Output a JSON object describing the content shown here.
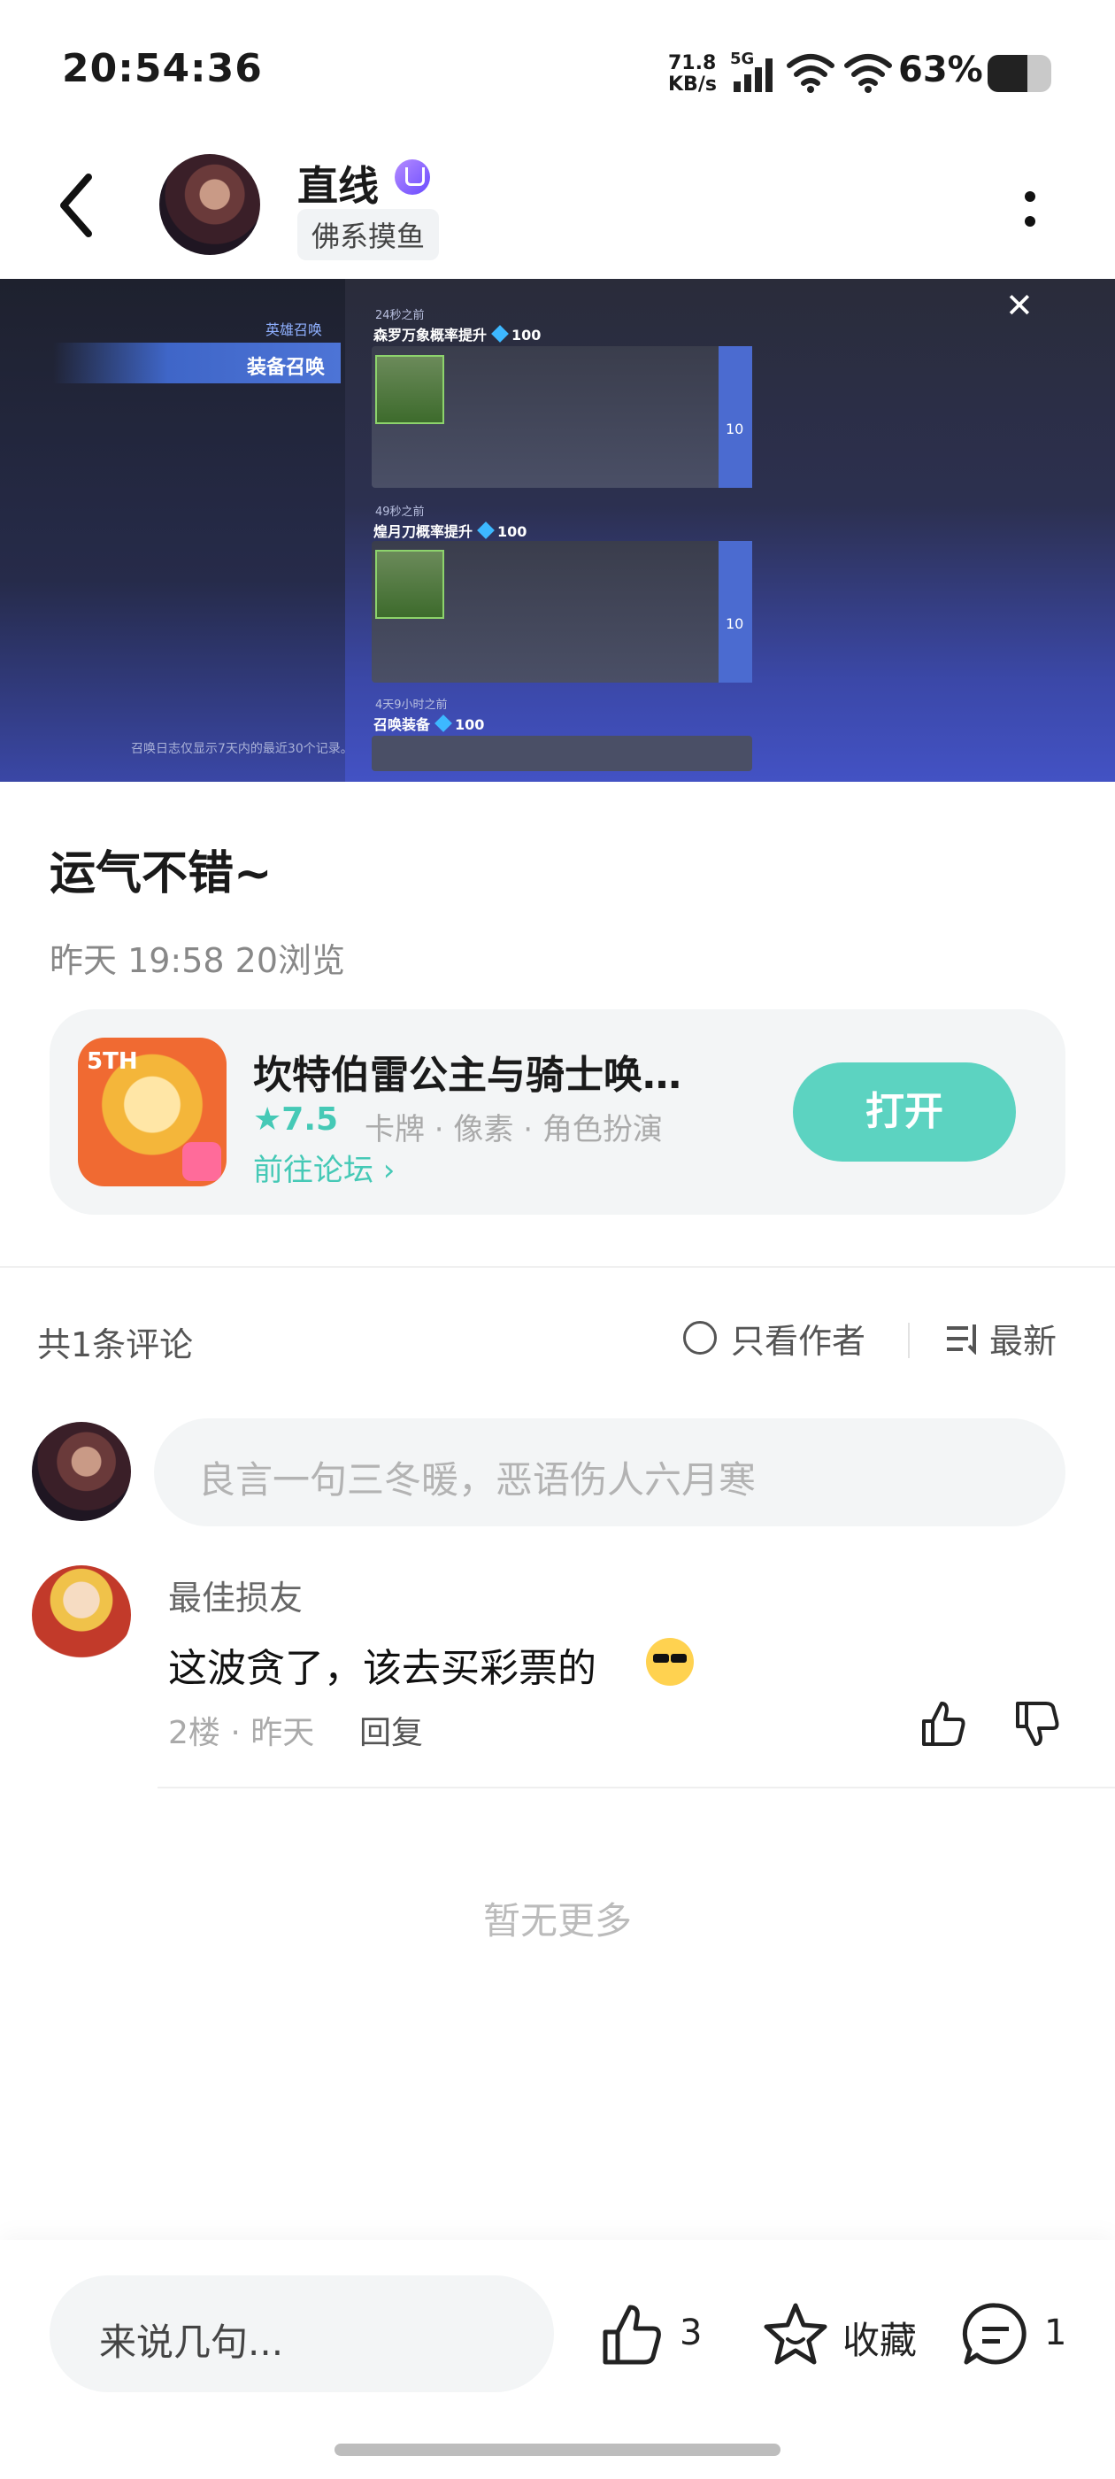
{
  "status_bar": {
    "time": "20:54:36",
    "net_speed_value": "71.8",
    "net_speed_unit": "KB/s",
    "network_type": "5G",
    "battery_percent": "63%",
    "battery_level": 0.63
  },
  "header": {
    "author_name": "直线",
    "author_tag": "佛系摸鱼"
  },
  "post_image": {
    "tab_hero": "英雄召唤",
    "tab_equipment": "装备召唤",
    "footnote": "召唤日志仅显示7天内的最近30个记录。",
    "records": [
      {
        "time": "24秒之前",
        "title": "森罗万象概率提升",
        "cost": "100",
        "side_count": "10"
      },
      {
        "time": "49秒之前",
        "title": "煌月刀概率提升",
        "cost": "100",
        "side_count": "10"
      },
      {
        "time": "4天9小时之前",
        "title": "召唤装备",
        "cost": "100"
      }
    ]
  },
  "post": {
    "title": "运气不错~",
    "meta": "昨天 19:58   20浏览"
  },
  "game_card": {
    "icon_badge": "5TH",
    "name": "坎特伯雷公主与骑士唤…",
    "rating": "★7.5",
    "tags": "卡牌 · 像素 · 角色扮演",
    "forum_link": "前往论坛 ›",
    "open_label": "打开"
  },
  "comments": {
    "count_label": "共1条评论",
    "author_only_label": "只看作者",
    "sort_label": "最新",
    "input_placeholder": "良言一句三冬暖，恶语伤人六月寒",
    "items": [
      {
        "name": "最佳损友",
        "text": "这波贪了，该去买彩票的",
        "meta": "2楼 · 昨天",
        "reply_label": "回复"
      }
    ],
    "no_more": "暂无更多"
  },
  "bottom_bar": {
    "input_placeholder": "来说几句...",
    "like_count": "3",
    "favorite_label": "收藏",
    "comment_count": "1"
  },
  "colors": {
    "accent": "#5cd3c1",
    "accent_text": "#45c9b6"
  }
}
